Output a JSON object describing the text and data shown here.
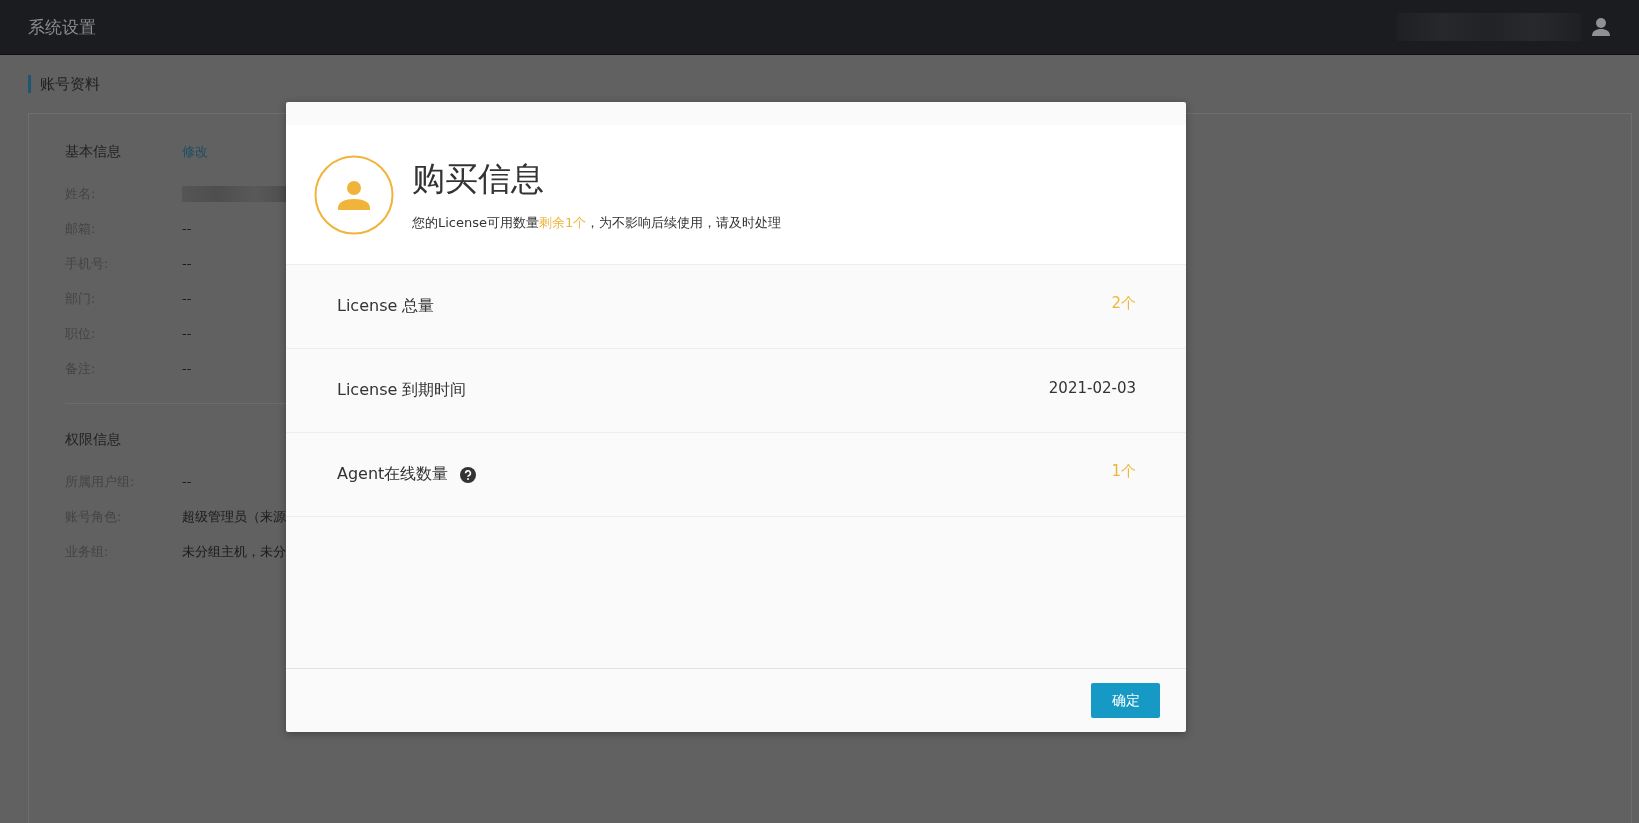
{
  "header": {
    "title": "系统设置"
  },
  "page": {
    "title": "账号资料"
  },
  "basic_info": {
    "heading": "基本信息",
    "edit_link": "修改",
    "fields": [
      {
        "label": "姓名:",
        "kind": "redacted"
      },
      {
        "label": "邮箱:",
        "kind": "text",
        "value": "--"
      },
      {
        "label": "手机号:",
        "kind": "text",
        "value": "--"
      },
      {
        "label": "部门:",
        "kind": "text",
        "value": "--"
      },
      {
        "label": "职位:",
        "kind": "text",
        "value": "--"
      },
      {
        "label": "备注:",
        "kind": "text",
        "value": "--"
      }
    ]
  },
  "permissions": {
    "heading": "权限信息",
    "fields": [
      {
        "label": "所属用户组:",
        "kind": "text",
        "value": "--"
      },
      {
        "label": "账号角色:",
        "kind": "text",
        "value": "超级管理员（来源"
      },
      {
        "label": "业务组:",
        "kind": "text",
        "value": "未分组主机，未分"
      }
    ]
  },
  "dialog": {
    "title": "购买信息",
    "notice": {
      "before": "您的License可用数量",
      "highlight": "剩余1个",
      "after": "，为不影响后续使用，请及时处理"
    },
    "rows": [
      {
        "label": "License 总量",
        "value": "2个",
        "highlight": true,
        "help": false
      },
      {
        "label": "License 到期时间",
        "value": "2021-02-03",
        "highlight": false,
        "help": false
      },
      {
        "label": "Agent在线数量",
        "value": "1个",
        "highlight": true,
        "help": true
      }
    ],
    "confirm_button": "确定"
  }
}
